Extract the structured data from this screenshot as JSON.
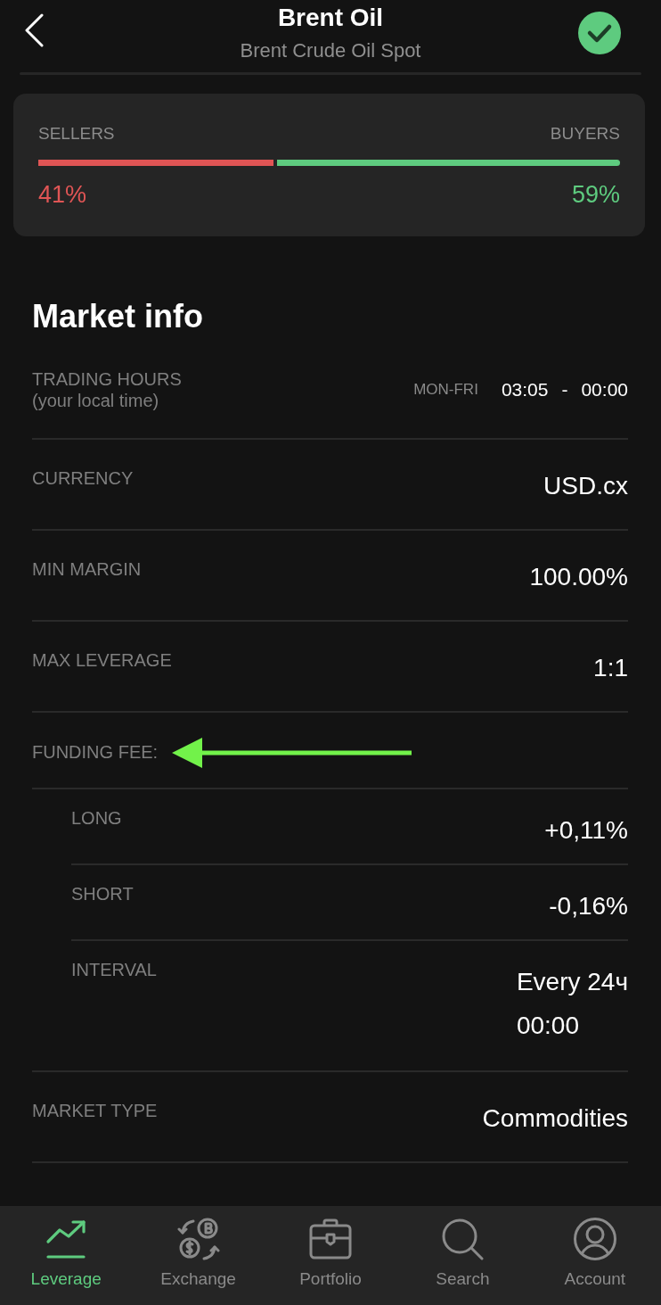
{
  "header": {
    "title": "Brent Oil",
    "subtitle": "Brent Crude Oil Spot"
  },
  "sentiment": {
    "sellers_label": "SELLERS",
    "buyers_label": "BUYERS",
    "level": 0.41,
    "sellers_value": "41%",
    "buyers_value": "59%"
  },
  "market_info": {
    "title": "Market info",
    "rows": [
      {
        "kind": "hours",
        "label": "TRADING HOURS",
        "note": "(your local time)",
        "days": "MON-FRI",
        "start": "03:05",
        "separator": "-",
        "end": "00:00"
      },
      {
        "kind": "value",
        "label": "CURRENCY",
        "value": "USD.cx"
      },
      {
        "kind": "value",
        "label": "MIN MARGIN",
        "value": "100.00%"
      },
      {
        "kind": "value",
        "label": "MAX LEVERAGE",
        "value": "1:1"
      },
      {
        "kind": "group",
        "label": "FUNDING FEE:",
        "pointer_arrow": true,
        "children": [
          {
            "label": "LONG",
            "value_lines": [
              "+0,11%"
            ]
          },
          {
            "label": "SHORT",
            "value_lines": [
              "-0,16%"
            ]
          },
          {
            "label": "INTERVAL",
            "value_lines": [
              "Every 24ч",
              "00:00"
            ]
          }
        ]
      },
      {
        "kind": "value",
        "label": "MARKET TYPE",
        "value": "Commodities"
      }
    ]
  },
  "nav": [
    {
      "label": "Leverage",
      "selected": true
    },
    {
      "label": "Exchange",
      "selected": false
    },
    {
      "label": "Portfolio",
      "selected": false
    },
    {
      "label": "Search",
      "selected": false
    },
    {
      "label": "Account",
      "selected": false
    }
  ]
}
